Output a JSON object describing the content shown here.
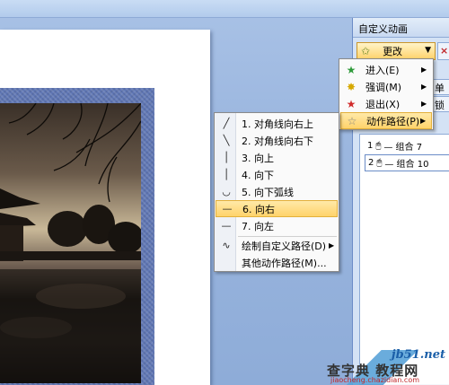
{
  "pane": {
    "title": "自定义动画",
    "change_button": "更改",
    "remove_icon": "×",
    "side_controls": [
      "单击",
      "锁定"
    ]
  },
  "effect_menu": {
    "items": [
      {
        "label": "进入(E)",
        "icon": "entrance-star-icon",
        "color": "#2e9a3a"
      },
      {
        "label": "强调(M)",
        "icon": "emphasis-star-icon",
        "color": "#d6a800"
      },
      {
        "label": "退出(X)",
        "icon": "exit-star-icon",
        "color": "#d02b2b"
      },
      {
        "label": "动作路径(P)",
        "icon": "motion-path-star-icon",
        "color": "#808080"
      }
    ],
    "active_index": 3
  },
  "motion_path_menu": {
    "items": [
      {
        "label": "1. 对角线向右上",
        "icon": "diagonal-up-right-icon"
      },
      {
        "label": "2. 对角线向右下",
        "icon": "diagonal-down-right-icon"
      },
      {
        "label": "3. 向上",
        "icon": "up-line-icon"
      },
      {
        "label": "4. 向下",
        "icon": "down-line-icon"
      },
      {
        "label": "5. 向下弧线",
        "icon": "arc-down-icon"
      },
      {
        "label": "6. 向右",
        "icon": "right-line-icon"
      },
      {
        "label": "7. 向左",
        "icon": "left-line-icon"
      }
    ],
    "draw_custom": "绘制自定义路径(D)",
    "more": "其他动作路径(M)...",
    "active_index": 5
  },
  "animation_list": [
    {
      "order": "1",
      "label": "— 组合 7",
      "selected": false
    },
    {
      "order": "2",
      "label": "— 组合 10",
      "selected": true
    }
  ],
  "watermark": {
    "site": "jb51.net",
    "text": "查字典 教程网",
    "url": "jiaocheng.chazidian.com"
  }
}
